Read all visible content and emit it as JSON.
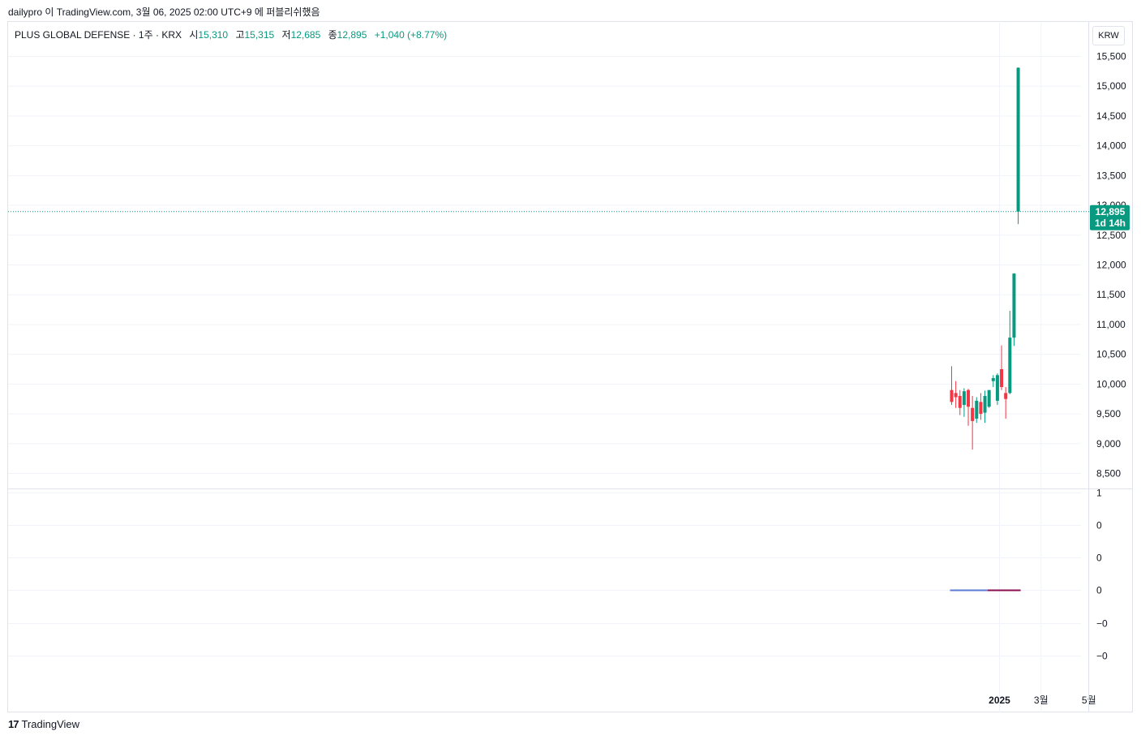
{
  "caption": "dailypro 이 TradingView.com, 3월 06, 2025 02:00 UTC+9 에 퍼블리쉬했음",
  "legend": {
    "symbol": "PLUS GLOBAL DEFENSE · 1주 · KRX",
    "open_label": "시",
    "open": "15,310",
    "high_label": "고",
    "high": "15,315",
    "low_label": "저",
    "low": "12,685",
    "close_label": "종",
    "close": "12,895",
    "change": "+1,040 (+8.77%)"
  },
  "currency_button": "KRW",
  "footer": {
    "logo_mark": "17",
    "logo_text": "TradingView"
  },
  "colors": {
    "up": "#089981",
    "down": "#f23645",
    "grid": "#f0f3fa",
    "line_blue": "#5b7bd5",
    "line_maroon": "#880e4f"
  },
  "chart_data": {
    "type": "candlestick",
    "main_axis": {
      "ylim": [
        8300,
        15750
      ],
      "ticks": [
        {
          "v": 8500,
          "label": "8,500"
        },
        {
          "v": 9000,
          "label": "9,000"
        },
        {
          "v": 9500,
          "label": "9,500"
        },
        {
          "v": 10000,
          "label": "10,000"
        },
        {
          "v": 10500,
          "label": "10,500"
        },
        {
          "v": 11000,
          "label": "11,000"
        },
        {
          "v": 11500,
          "label": "11,500"
        },
        {
          "v": 12000,
          "label": "12,000"
        },
        {
          "v": 12500,
          "label": "12,500"
        },
        {
          "v": 13000,
          "label": "13,000"
        },
        {
          "v": 13500,
          "label": "13,500"
        },
        {
          "v": 14000,
          "label": "14,000"
        },
        {
          "v": 14500,
          "label": "14,500"
        },
        {
          "v": 15000,
          "label": "15,000"
        },
        {
          "v": 15500,
          "label": "15,500"
        }
      ]
    },
    "last_price": {
      "value": 12895,
      "label": "12,895",
      "countdown": "1d 14h"
    },
    "x_labels": [
      {
        "label": "2025",
        "bold": true,
        "week": 11.5
      },
      {
        "label": "3월",
        "bold": false,
        "week": 21.5
      },
      {
        "label": "5월",
        "bold": false,
        "week": 33
      }
    ],
    "candles": [
      {
        "o": 9900,
        "h": 10300,
        "l": 9650,
        "c": 9700
      },
      {
        "o": 9850,
        "h": 10050,
        "l": 9600,
        "c": 9780
      },
      {
        "o": 9800,
        "h": 9900,
        "l": 9480,
        "c": 9600
      },
      {
        "o": 9650,
        "h": 9930,
        "l": 9450,
        "c": 9880
      },
      {
        "o": 9900,
        "h": 9920,
        "l": 9300,
        "c": 9620
      },
      {
        "o": 9600,
        "h": 9800,
        "l": 8900,
        "c": 9380
      },
      {
        "o": 9420,
        "h": 9780,
        "l": 9350,
        "c": 9720
      },
      {
        "o": 9700,
        "h": 9850,
        "l": 9400,
        "c": 9500
      },
      {
        "o": 9520,
        "h": 9890,
        "l": 9350,
        "c": 9800
      },
      {
        "o": 9620,
        "h": 9900,
        "l": 9600,
        "c": 9900
      },
      {
        "o": 10050,
        "h": 10150,
        "l": 9950,
        "c": 10100
      },
      {
        "o": 9720,
        "h": 10180,
        "l": 9650,
        "c": 10150
      },
      {
        "o": 10250,
        "h": 10650,
        "l": 9900,
        "c": 9950
      },
      {
        "o": 9850,
        "h": 9950,
        "l": 9420,
        "c": 9750
      },
      {
        "o": 9850,
        "h": 11230,
        "l": 9830,
        "c": 10780
      },
      {
        "o": 10780,
        "h": 11860,
        "l": 10640,
        "c": 11855
      },
      {
        "o": 12895,
        "h": 15315,
        "l": 12685,
        "c": 15310
      }
    ],
    "indicator_axis": {
      "ticks": [
        "1",
        "0",
        "0",
        "0",
        "−0",
        "−0"
      ],
      "series": [
        {
          "from": 0,
          "to": 9,
          "value": 0,
          "color": "#5b7bd5"
        },
        {
          "from": 9,
          "to": 17,
          "value": 0,
          "color": "#880e4f"
        }
      ]
    }
  }
}
